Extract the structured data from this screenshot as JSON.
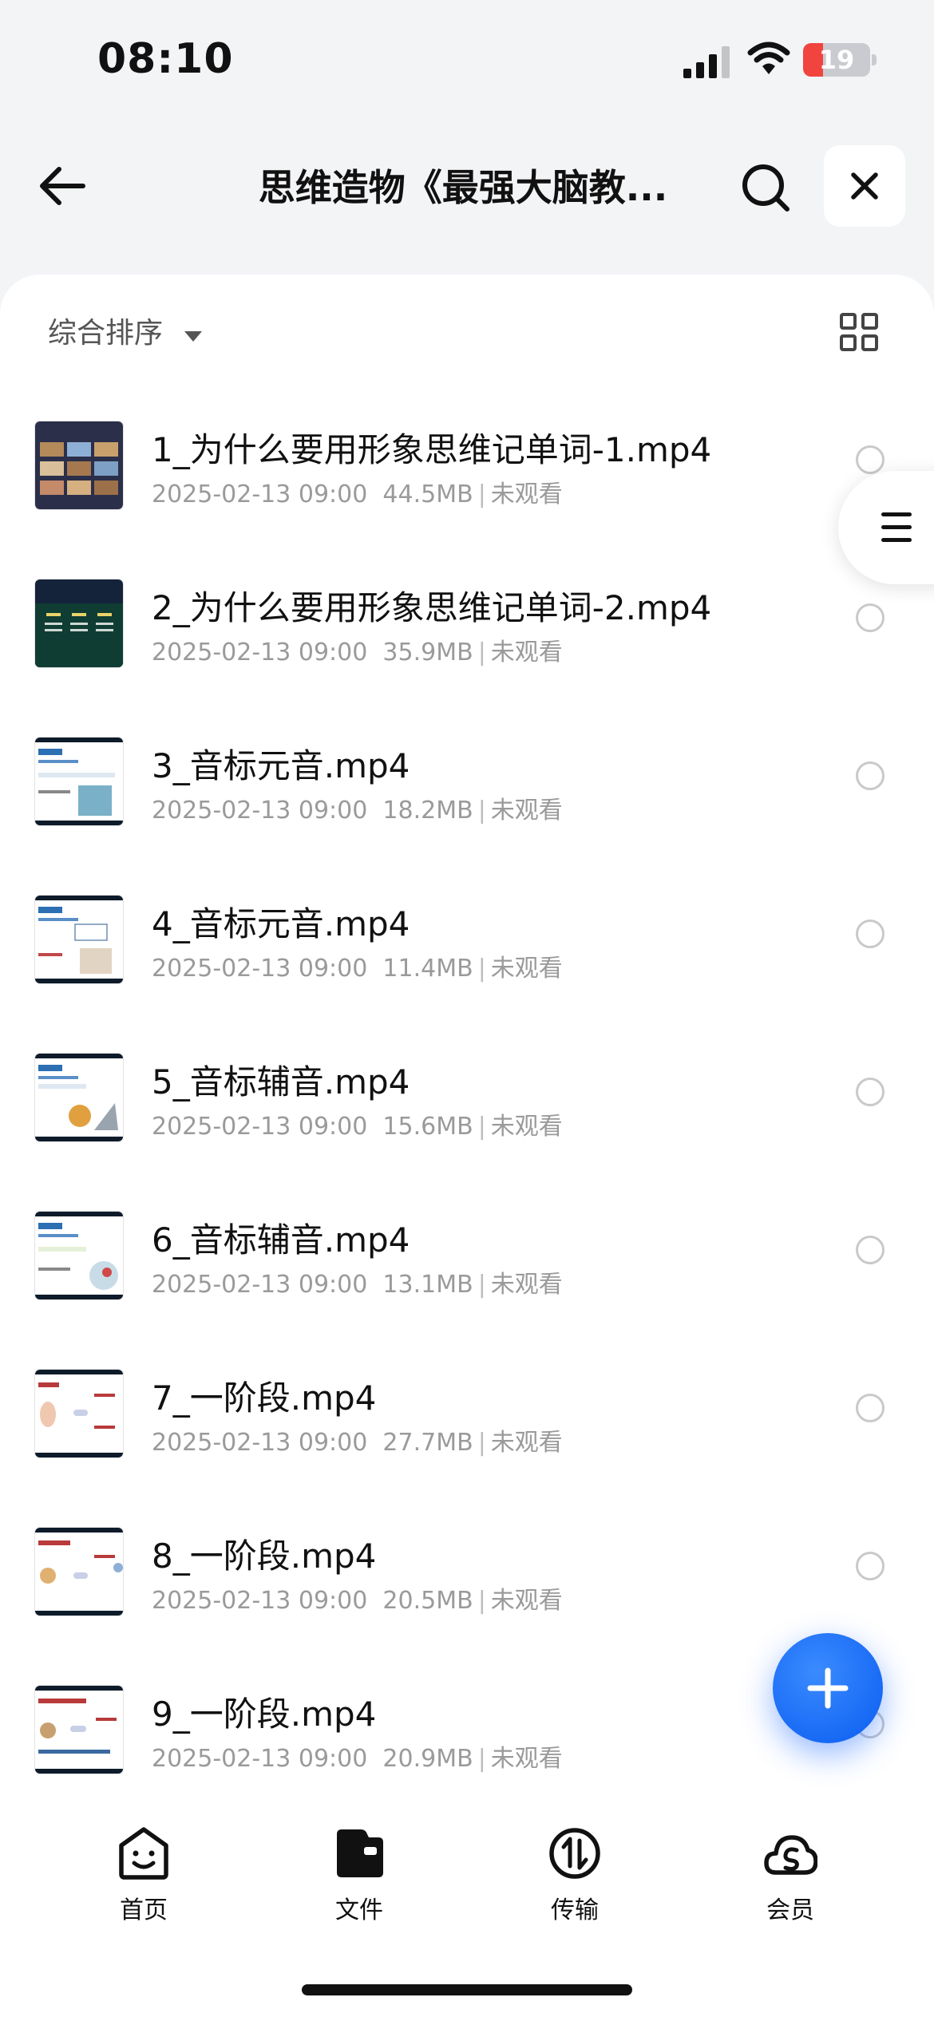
{
  "status_bar": {
    "time": "08:10",
    "battery_level": "19",
    "icons": [
      "signal-icon",
      "wifi-icon",
      "battery-icon"
    ]
  },
  "header": {
    "title": "思维造物《最强大脑教...",
    "icons": [
      "back-arrow-icon",
      "search-icon",
      "close-icon"
    ]
  },
  "toolbar": {
    "sort_label": "综合排序",
    "icons": [
      "sort-caret-icon",
      "grid-view-icon"
    ]
  },
  "files": [
    {
      "name": "1_为什么要用形象思维记单词-1.mp4",
      "date": "2025-02-13 09:00",
      "size": "44.5MB",
      "status": "未观看"
    },
    {
      "name": "2_为什么要用形象思维记单词-2.mp4",
      "date": "2025-02-13 09:00",
      "size": "35.9MB",
      "status": "未观看"
    },
    {
      "name": "3_音标元音.mp4",
      "date": "2025-02-13 09:00",
      "size": "18.2MB",
      "status": "未观看"
    },
    {
      "name": "4_音标元音.mp4",
      "date": "2025-02-13 09:00",
      "size": "11.4MB",
      "status": "未观看"
    },
    {
      "name": "5_音标辅音.mp4",
      "date": "2025-02-13 09:00",
      "size": "15.6MB",
      "status": "未观看"
    },
    {
      "name": "6_音标辅音.mp4",
      "date": "2025-02-13 09:00",
      "size": "13.1MB",
      "status": "未观看"
    },
    {
      "name": "7_一阶段.mp4",
      "date": "2025-02-13 09:00",
      "size": "27.7MB",
      "status": "未观看"
    },
    {
      "name": "8_一阶段.mp4",
      "date": "2025-02-13 09:00",
      "size": "20.5MB",
      "status": "未观看"
    },
    {
      "name": "9_一阶段.mp4",
      "date": "2025-02-13 09:00",
      "size": "20.9MB",
      "status": "未观看"
    }
  ],
  "floating": {
    "icons": [
      "menu-icon",
      "plus-icon"
    ]
  },
  "nav": {
    "items": [
      {
        "label": "首页",
        "icon": "home-smile-icon"
      },
      {
        "label": "文件",
        "icon": "folder-icon"
      },
      {
        "label": "传输",
        "icon": "transfer-icon"
      },
      {
        "label": "会员",
        "icon": "vip-cloud-icon"
      }
    ]
  },
  "colors": {
    "accent": "#0a5cf0",
    "background": "#f3f4f6",
    "battery_low": "#f2443f"
  }
}
